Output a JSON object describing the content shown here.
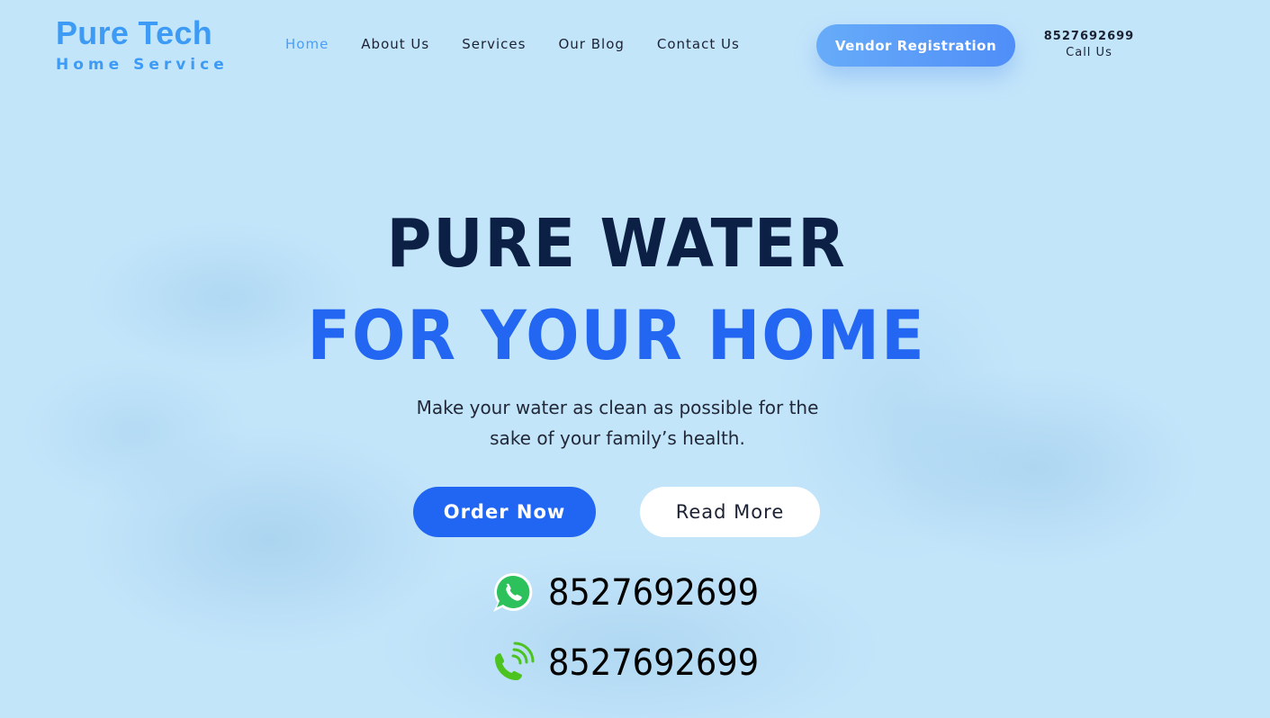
{
  "brand": {
    "title": "Pure Tech",
    "subtitle": "Home Service"
  },
  "nav": {
    "items": [
      {
        "label": "Home",
        "active": true
      },
      {
        "label": "About Us"
      },
      {
        "label": "Services"
      },
      {
        "label": "Our Blog"
      },
      {
        "label": "Contact Us"
      }
    ]
  },
  "header": {
    "vendor_button": "Vendor Registration",
    "phone": "8527692699",
    "phone_label": "Call Us"
  },
  "hero": {
    "headline_line1": "PURE WATER",
    "headline_line2": "FOR YOUR HOME",
    "lead_line1": "Make your water as clean as possible for the",
    "lead_line2": "sake of your family’s health.",
    "order_button": "Order Now",
    "read_button": "Read More",
    "whatsapp_number": "8527692699",
    "call_number": "8527692699"
  },
  "colors": {
    "background": "#c3e5fa",
    "brand": "#3d9bf5",
    "accent": "#2166f3",
    "headline_dark": "#0c1f45",
    "whatsapp_green": "#25c05a",
    "call_green": "#4cc31f"
  },
  "icons": {
    "whatsapp": "whatsapp-icon",
    "phone": "phone-ringing-icon"
  }
}
